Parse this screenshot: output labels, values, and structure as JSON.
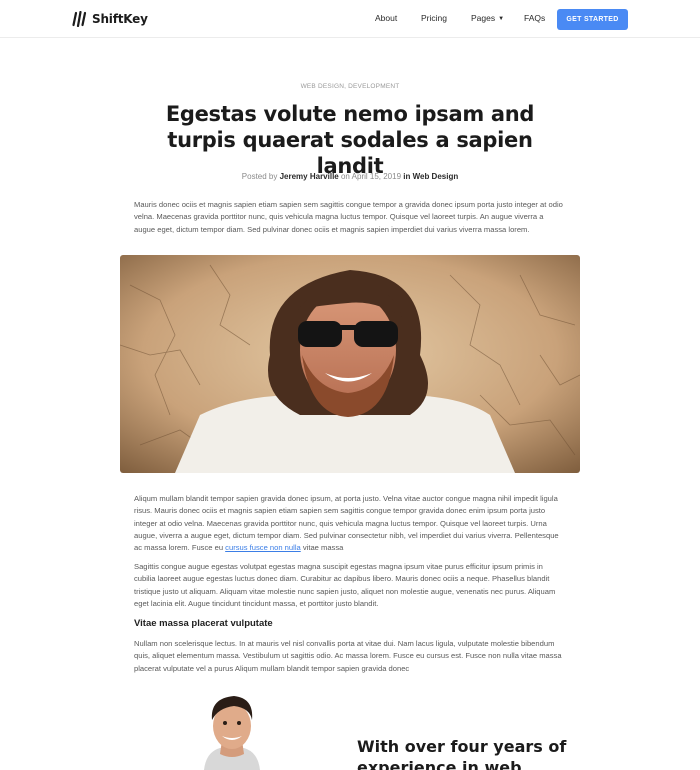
{
  "header": {
    "logo_text": "ShiftKey",
    "nav": {
      "about": "About",
      "pricing": "Pricing",
      "pages": "Pages",
      "faqs": "FAQs"
    },
    "cta": "GET STARTED"
  },
  "article": {
    "categories": "WEB DESIGN, DEVELOPMENT",
    "title": "Egestas volute nemo ipsam and turpis quaerat sodales a sapien landit",
    "byline": {
      "prefix": "Posted by ",
      "author": "Jeremy Harville",
      "middle": " on April 15, 2019 ",
      "in_label": "in Web Design"
    },
    "intro": "Mauris donec ociis et magnis sapien etiam sapien sem sagittis congue tempor a gravida donec ipsum porta justo integer at odio velna. Maecenas gravida porttitor nunc, quis vehicula magna luctus tempor. Quisque vel laoreet turpis. An augue viverra a augue eget, dictum tempor diam. Sed pulvinar donec ociis et magnis sapien imperdiet dui varius viverra massa lorem.",
    "para2_text": "Aliqum mullam blandit tempor sapien gravida donec ipsum, at porta justo. Velna vitae auctor congue magna nihil impedit ligula risus. Mauris donec ociis et magnis sapien etiam sapien sem sagittis congue tempor gravida donec enim ipsum porta justo integer at odio velna. Maecenas gravida porttitor nunc, quis vehicula magna luctus tempor. Quisque vel laoreet turpis. Urna augue, viverra a augue eget, dictum tempor diam. Sed pulvinar consectetur nibh, vel imperdiet dui varius viverra. Pellentesque ac massa lorem. Fusce eu ",
    "para2_link": "cursus fusce non nulla",
    "para2_tail": " vitae massa",
    "para3": "Sagittis congue augue egestas volutpat egestas magna suscipit egestas magna ipsum vitae purus efficitur ipsum primis in cubilia laoreet augue egestas luctus donec diam. Curabitur ac dapibus libero. Mauris donec ociis a neque. Phasellus blandit tristique justo ut aliquam. Aliquam vitae molestie nunc sapien justo, aliquet non molestie augue, venenatis nec purus. Aliquam eget lacinia elit. Augue tincidunt tincidunt massa, et porttitor justo blandit.",
    "subheading": "Vitae massa placerat vulputate",
    "para4": "Nullam non scelerisque lectus. In at mauris vel nisl convallis porta at vitae dui. Nam lacus ligula, vulputate molestie bibendum quis, aliquet elementum massa. Vestibulum ut sagittis odio. Ac massa lorem. Fusce eu cursus est. Fusce non nulla vitae massa placerat vulputate vel a purus Aliqum mullam blandit tempor sapien gravida donec"
  },
  "promo": {
    "heading": "With over four years of experience in web design"
  },
  "colors": {
    "accent": "#4a8af4",
    "link": "#3b7ee6"
  }
}
